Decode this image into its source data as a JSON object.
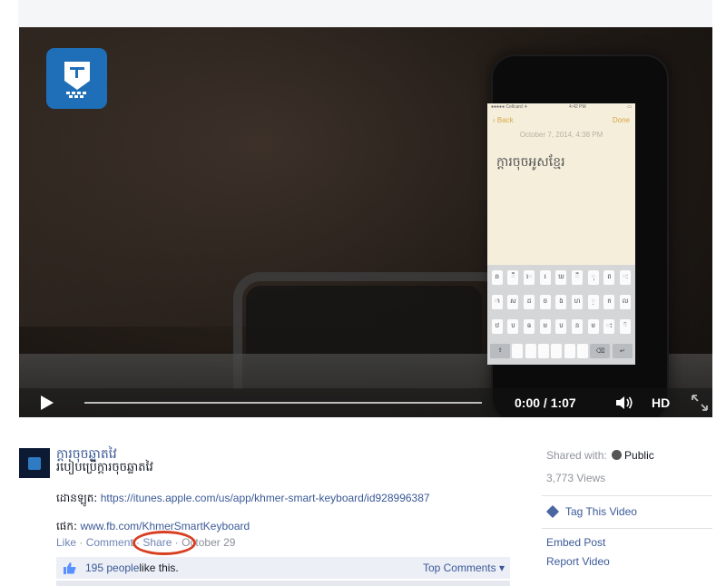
{
  "video": {
    "phone_screen": {
      "status_carrier": "●●●●● Cellcard ✈",
      "status_time": "4:42 PM",
      "back": "Back",
      "done": "Done",
      "note_date": "October 7, 2014, 4:38 PM",
      "note_text": "ក្តារចុចអូសខ្មែរ",
      "keyboard_rows": [
        [
          "ឆ",
          "ឹ",
          "េ",
          "រ",
          "ឃ",
          "ឺ",
          "ុ",
          "ព",
          "ៈ"
        ],
        [
          "ា",
          "ស",
          "ដ",
          "ថ",
          "ង",
          "ហ",
          "្",
          "ក",
          "ល"
        ],
        [
          "ឋ",
          "ប",
          "ឲ",
          "ម",
          "ប",
          "ន",
          "ម",
          "ះ",
          "៊"
        ],
        [
          "៖",
          "",
          "",
          "",
          "",
          "",
          "",
          "⌫",
          "↵"
        ]
      ]
    },
    "time_display": "0:00 / 1:07",
    "hd_label": "HD",
    "progress_fraction": 0.0
  },
  "post": {
    "page_name": "ក្តារចុចឆ្លាតវៃ",
    "title": "របៀបប្រើក្តារចុចឆ្លាតវៃ",
    "download_label": "ដោនឡូត:",
    "download_url": "https://itunes.apple.com/us/app/khmer-smart-keyboard/id928996387",
    "page_label": "ផេក:",
    "page_url": "www.fb.com/KhmerSmartKeyboard",
    "actions": {
      "like": "Like",
      "comment": "Comment",
      "share": "Share",
      "date": "October 29",
      "separator": " · "
    },
    "likes": {
      "people": "195 people",
      "text": " like this.",
      "top_comments": "Top Comments ▾"
    }
  },
  "sidebar": {
    "shared_with_label": "Shared with:",
    "audience": "Public",
    "views": "3,773 Views",
    "tag_video": "Tag This Video",
    "embed_post": "Embed Post",
    "report_video": "Report Video"
  },
  "icons": {
    "play": "play-icon",
    "volume": "volume-icon",
    "fullscreen": "fullscreen-icon",
    "thumb": "thumbs-up-icon",
    "globe": "globe-icon",
    "tag": "tag-icon"
  },
  "colors": {
    "link": "#3b5998",
    "highlight_circle": "#d83f22",
    "app_logo": "#1f6fb8"
  }
}
